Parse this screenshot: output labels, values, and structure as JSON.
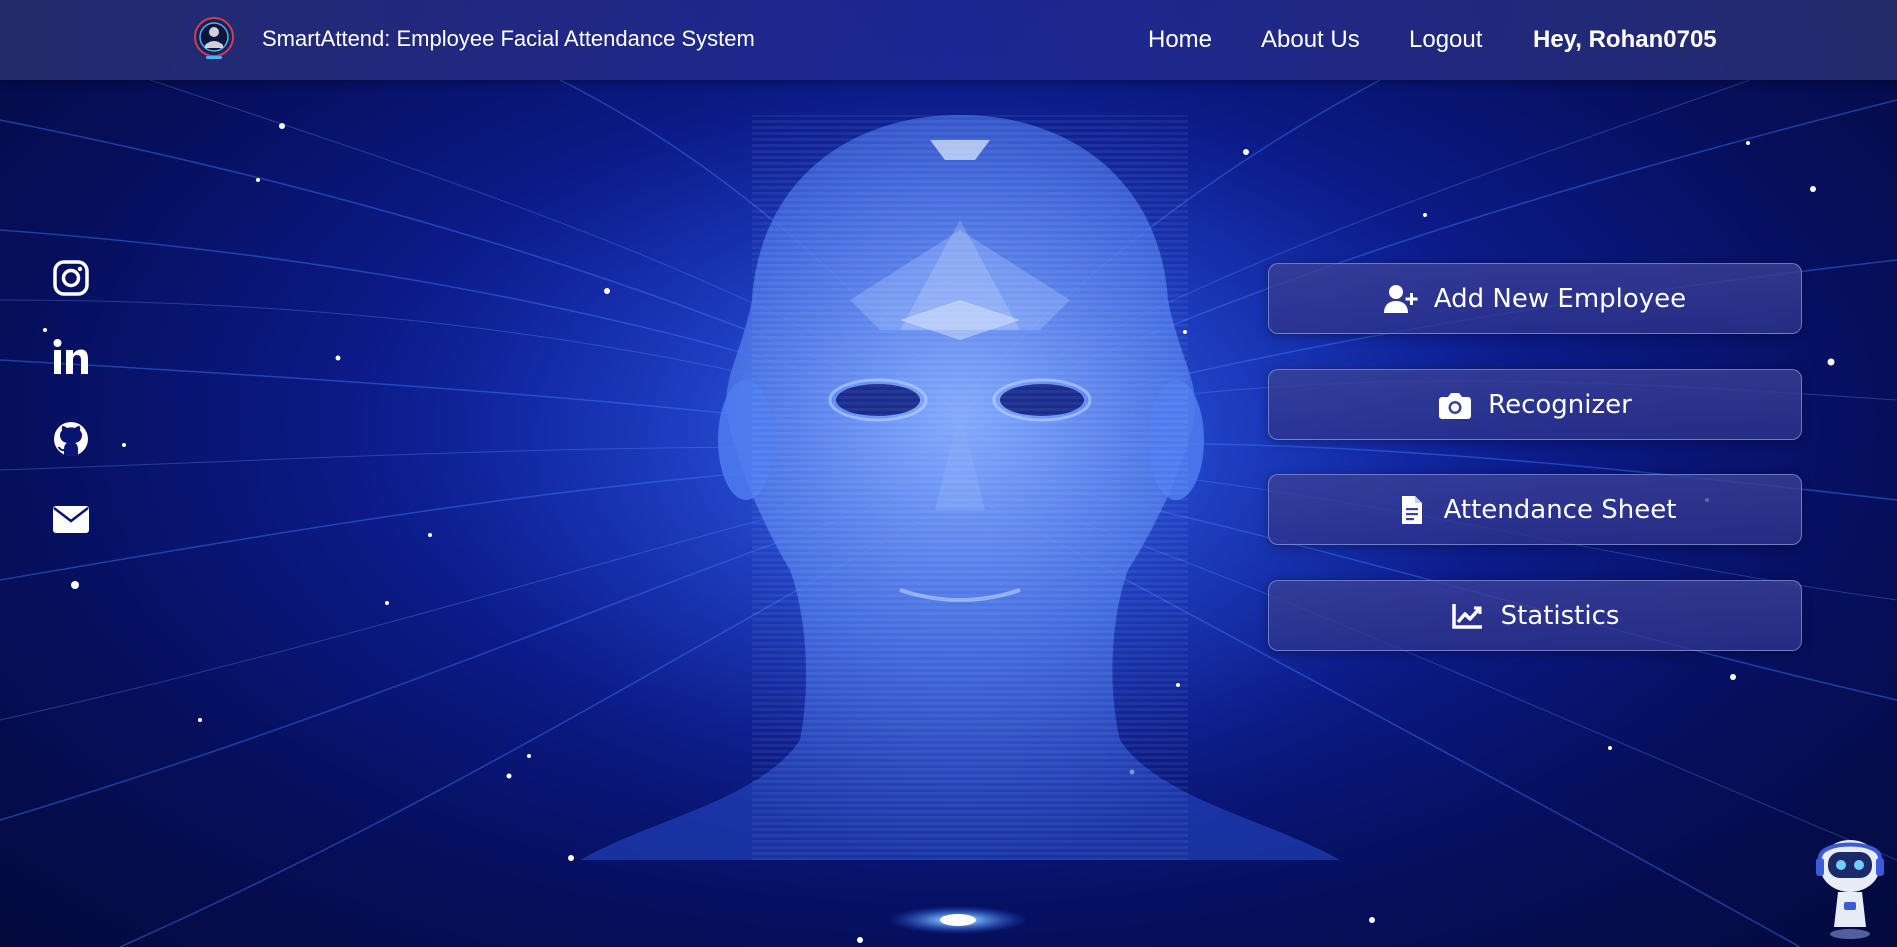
{
  "navbar": {
    "brand_title": "SmartAttend: Employee Facial Attendance System",
    "links": {
      "home": "Home",
      "about": "About Us",
      "logout": "Logout"
    },
    "user_greeting": "Hey, Rohan0705"
  },
  "social": [
    {
      "icon": "instagram-icon"
    },
    {
      "icon": "linkedin-icon"
    },
    {
      "icon": "github-icon"
    },
    {
      "icon": "mail-icon"
    }
  ],
  "actions": {
    "add_employee": {
      "label": "Add New Employee",
      "icon": "user-plus-icon"
    },
    "recognizer": {
      "label": "Recognizer",
      "icon": "camera-icon"
    },
    "attendance_sheet": {
      "label": "Attendance Sheet",
      "icon": "document-icon"
    },
    "statistics": {
      "label": "Statistics",
      "icon": "chart-line-icon"
    }
  },
  "chatbot": {
    "icon": "robot-icon"
  },
  "colors": {
    "background_dark": "#040a3c",
    "background_glow": "#2a4fe0",
    "navbar": "#282d6e",
    "button_fill": "#3c4296",
    "button_border": "#aab4f0",
    "text": "#ffffff"
  }
}
